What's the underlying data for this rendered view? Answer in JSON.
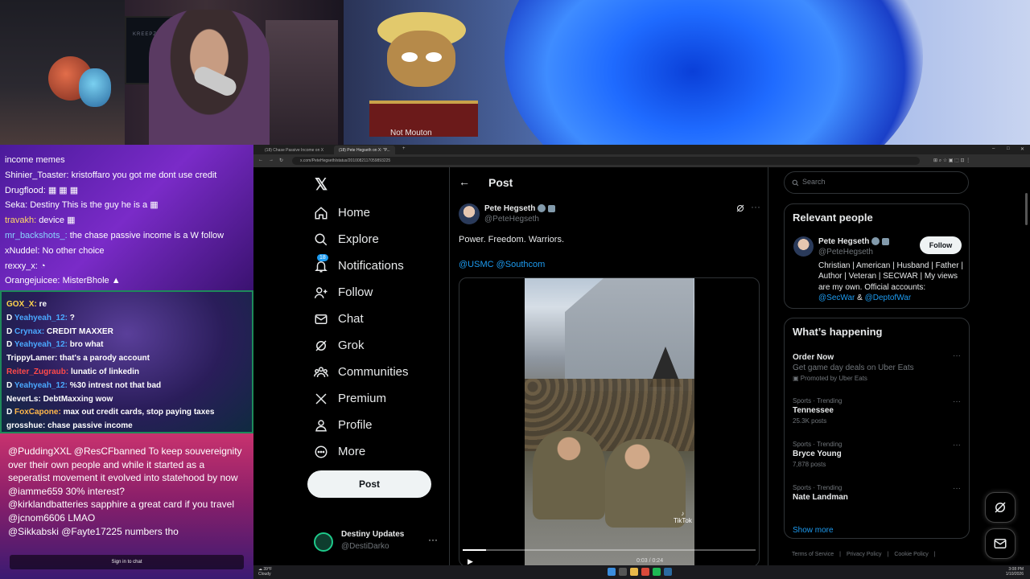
{
  "stream": {
    "cam_monitor_text": "KREEPZYO DONATES $5",
    "banner_caption": "Not Mouton"
  },
  "chat_top": {
    "lines": [
      {
        "user": "",
        "text": "income memes"
      },
      {
        "user": "Shinier_Toaster:",
        "text": "kristoffaro you got me dont use credit"
      },
      {
        "user": "Drugflood:",
        "text": ""
      },
      {
        "user": "Seka:",
        "text": "Destiny This is the guy he is a"
      },
      {
        "user": "travakh:",
        "text": "device"
      },
      {
        "user": "mr_backshots_:",
        "text": "the chase passive income is a W follow"
      },
      {
        "user": "xNuddel:",
        "text": "No other choice"
      },
      {
        "user": "rexxy_x:",
        "text": ""
      },
      {
        "user": "Orangejuicee:",
        "text": "MisterBhole"
      }
    ],
    "colors": {
      "travakh": "#ffd966",
      "mr_backshots_": "#8ad4ff"
    }
  },
  "chat_mid": {
    "lines": [
      {
        "user": "GOX_X:",
        "text": "re",
        "color": "#ffd34d"
      },
      {
        "user": "Yeahyeah_12:",
        "text": "?",
        "color": "#4aa8ff"
      },
      {
        "user": "Crynax:",
        "text": "CREDIT MAXXER",
        "color": "#4aa8ff"
      },
      {
        "user": "Yeahyeah_12:",
        "text": "bro what",
        "color": "#4aa8ff"
      },
      {
        "user": "TrippyLamer:",
        "text": "that's a parody account",
        "color": "#ffffff"
      },
      {
        "user": "Reiter_Zugraub:",
        "text": "lunatic of linkedin",
        "color": "#ff4a4a"
      },
      {
        "user": "Yeahyeah_12:",
        "text": "%30 intrest not that bad",
        "color": "#4aa8ff"
      },
      {
        "user": "NeverLs:",
        "text": "DebtMaxxing wow",
        "color": "#ffffff"
      },
      {
        "user": "FoxCapone:",
        "text": "max out credit cards, stop paying taxes",
        "color": "#ffb84a"
      },
      {
        "user": "grosshue:",
        "text": "chase passive income",
        "color": "#ffffff"
      }
    ]
  },
  "chat_bottom": {
    "lines": [
      "@PuddingXXL @ResCFbanned To keep souvereignity over their own people and while it started as a seperatist movement it evolved into statehood by now",
      "@iamme659 30% interest?",
      "@kirklandbatteries sapphire a great card if you travel",
      "@jcnom6606 LMAO",
      "@Sikkabski @Fayte17225 numbers tho"
    ],
    "signin": "Sign in to chat"
  },
  "browser": {
    "tabs": [
      "(18) Chase Passive Income on X",
      "(18) Pete Hegseth on X: \"P..."
    ],
    "url": "x.com/PeteHegseth/status/2010082117059893225"
  },
  "nav": {
    "items": [
      {
        "label": "Home",
        "icon": "home-icon"
      },
      {
        "label": "Explore",
        "icon": "search-icon"
      },
      {
        "label": "Notifications",
        "icon": "bell-icon",
        "badge": "18"
      },
      {
        "label": "Follow",
        "icon": "person-add-icon"
      },
      {
        "label": "Chat",
        "icon": "mail-icon"
      },
      {
        "label": "Grok",
        "icon": "grok-icon"
      },
      {
        "label": "Communities",
        "icon": "communities-icon"
      },
      {
        "label": "Premium",
        "icon": "x-icon"
      },
      {
        "label": "Profile",
        "icon": "person-icon"
      },
      {
        "label": "More",
        "icon": "more-circle-icon"
      }
    ],
    "post_button": "Post",
    "account": {
      "name": "Destiny Updates",
      "handle": "@DestiDarko"
    }
  },
  "post": {
    "header": "Post",
    "author": "Pete Hegseth",
    "handle": "@PeteHegseth",
    "text": "Power. Freedom. Warriors.",
    "mentions": "@USMC @Southcom",
    "video": {
      "watermark": "TikTok",
      "progress": 0.08,
      "time": "0:03 / 0:24"
    }
  },
  "right": {
    "search_placeholder": "Search",
    "relevant": {
      "title": "Relevant people",
      "name": "Pete Hegseth",
      "handle": "@PeteHegseth",
      "follow": "Follow",
      "bio": "Christian | American | Husband | Father | Author | Veteran | SECWAR | My views are my own. Official accounts:",
      "bio_link1": "@SecWar",
      "bio_amp": " & ",
      "bio_link2": "@DeptofWar"
    },
    "happening": {
      "title": "What’s happening",
      "trends": [
        {
          "meta": "",
          "title": "Order Now",
          "desc": "Get game day deals on Uber Eats",
          "count": "Promoted by Uber Eats"
        },
        {
          "meta": "Sports · Trending",
          "title": "Tennessee",
          "desc": "",
          "count": "25.3K posts"
        },
        {
          "meta": "Sports · Trending",
          "title": "Bryce Young",
          "desc": "",
          "count": "7,878 posts"
        },
        {
          "meta": "Sports · Trending",
          "title": "Nate Landman",
          "desc": "",
          "count": ""
        }
      ],
      "show_more": "Show more"
    },
    "footer": [
      "Terms of Service",
      "|",
      "Privacy Policy",
      "|",
      "Cookie Policy",
      "|"
    ]
  },
  "taskbar": {
    "weather": "39°F",
    "weather_sub": "Cloudy",
    "time": "3:08 PM",
    "date": "1/10/2026"
  }
}
